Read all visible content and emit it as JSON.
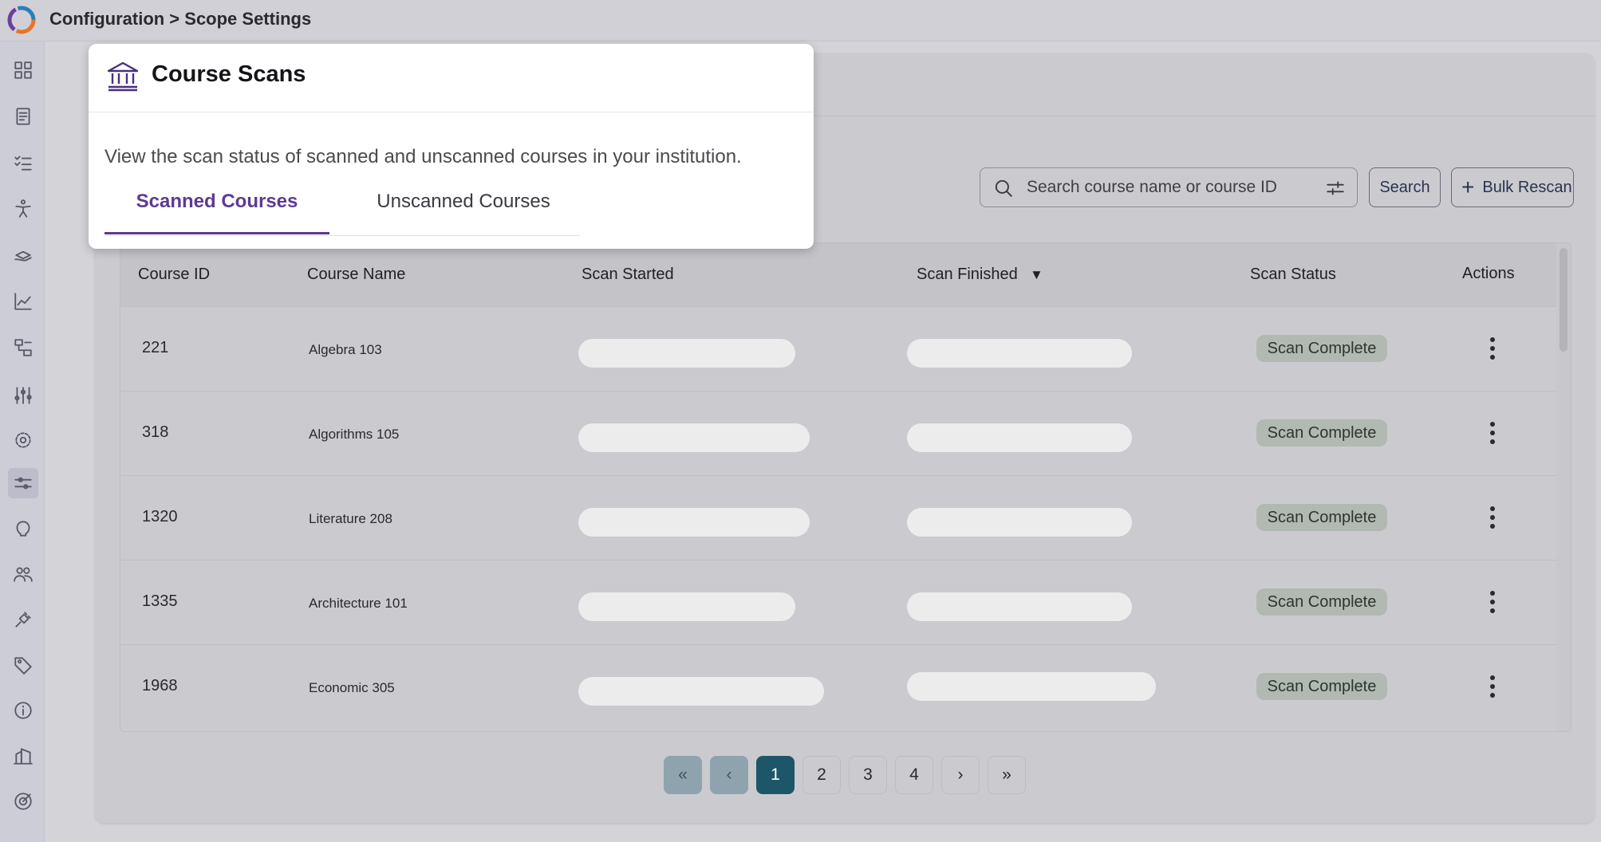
{
  "header": {
    "breadcrumb": "Configuration > Scope Settings"
  },
  "sidebar": {
    "icons": [
      "dashboard-icon",
      "document-icon",
      "checklist-icon",
      "accessibility-icon",
      "learning-icon",
      "analytics-icon",
      "workflow-icon",
      "adjustments-icon",
      "gear-icon",
      "sliders-icon",
      "brain-icon",
      "users-icon",
      "plug-icon",
      "tag-icon",
      "info-icon",
      "institution-icon",
      "target-icon"
    ],
    "active": "sliders-icon"
  },
  "popover": {
    "title": "Course Scans",
    "description": "View the scan status of scanned and unscanned courses in your institution.",
    "tabs": [
      {
        "label": "Scanned Courses",
        "active": true
      },
      {
        "label": "Unscanned Courses",
        "active": false
      }
    ]
  },
  "search": {
    "placeholder": "Search course name or course ID",
    "button_label": "Search",
    "bulk_label": "Bulk Rescan"
  },
  "table": {
    "columns": [
      "Course ID",
      "Course Name",
      "Scan Started",
      "Scan Finished",
      "Scan Status",
      "Actions"
    ],
    "sort_indicator": "▼",
    "rows": [
      {
        "id": "221",
        "name": "Algebra 103",
        "status": "Scan Complete"
      },
      {
        "id": "318",
        "name": "Algorithms 105",
        "status": "Scan Complete"
      },
      {
        "id": "1320",
        "name": "Literature 208",
        "status": "Scan Complete"
      },
      {
        "id": "1335",
        "name": "Architecture 101",
        "status": "Scan Complete"
      },
      {
        "id": "1968",
        "name": "Economic 305",
        "status": "Scan Complete"
      }
    ]
  },
  "pagination": {
    "first": "«",
    "prev": "‹",
    "pages": [
      "1",
      "2",
      "3",
      "4"
    ],
    "next": "›",
    "last": "»",
    "current": "1"
  },
  "colors": {
    "accent": "#5d3a94",
    "current_page": "#1d5669",
    "badge_bg": "#b2b8b2"
  }
}
